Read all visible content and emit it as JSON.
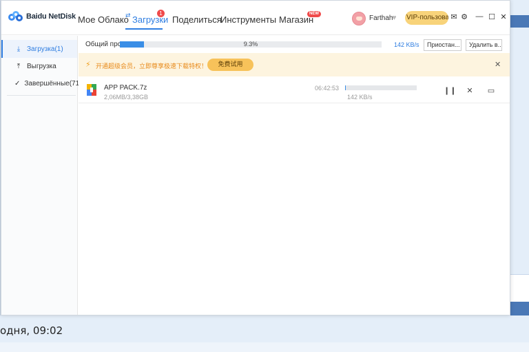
{
  "app": {
    "logo_text": "Baidu NetDisk",
    "nav": [
      {
        "label": "Мое Облако"
      },
      {
        "label": "Загрузки"
      },
      {
        "label": "Поделиться"
      },
      {
        "label": "Инструменты"
      },
      {
        "label": "Магазин"
      }
    ],
    "downloads_badge": "1",
    "store_badge": "NEW",
    "username": "Farthah",
    "vip_label": "VIP-пользоват...",
    "window_controls": [
      "mail-icon",
      "settings-icon",
      "minimize-icon",
      "maximize-icon",
      "close-icon"
    ]
  },
  "sidebar": {
    "items": [
      {
        "label": "Загрузка(1)",
        "icon": "download-icon",
        "active": true
      },
      {
        "label": "Выгрузка",
        "icon": "upload-icon",
        "active": false
      },
      {
        "label": "Завершённые(71)",
        "icon": "check-circle-icon",
        "active": false
      }
    ]
  },
  "summary": {
    "label": "Общий прс",
    "percent_text": "9.3%",
    "progress": 0.093,
    "speed": "142 KB/s",
    "pause_all_label": "Приостан...",
    "delete_all_label": "Удалить в..."
  },
  "promo": {
    "text": "开通超级会员，立即尊享极速下载特权！",
    "button": "免费试用"
  },
  "tasks": [
    {
      "name": "APP PACK.7z",
      "size": "2,06MB/3,38GB",
      "remaining": "06:42:53",
      "speed": "142 KB/s",
      "progress": 0.001,
      "icon": "archive-file-icon"
    }
  ],
  "background": {
    "footer_text": "одня, 09:02"
  },
  "colors": {
    "accent": "#2e7de1",
    "progress": "#3a8ee6",
    "promo_bg": "#fdf4df",
    "promo_text": "#e88a1a",
    "vip_gold": "#f8d37a",
    "badge_red": "#f04a4a"
  }
}
